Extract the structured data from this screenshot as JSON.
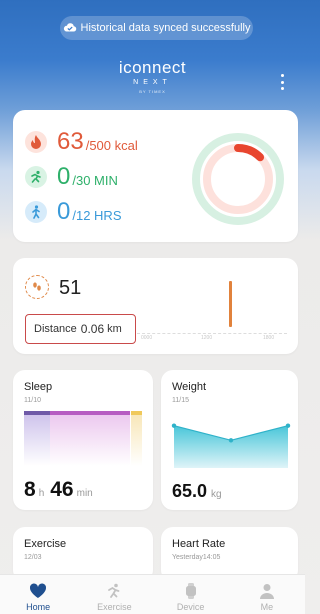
{
  "toast": {
    "text": "Historical data synced successfully",
    "icon": "cloud-check-icon"
  },
  "brand": {
    "name": "iconnect",
    "sub": "NEXT",
    "by": "BY TIMEX"
  },
  "activity": {
    "calories": {
      "value": "63",
      "goal": "/500 kcal",
      "color": "#e05a3a",
      "icon": "flame-icon"
    },
    "exercise": {
      "value": "0",
      "goal": "/30 MIN",
      "color": "#2eb06a",
      "icon": "running-icon"
    },
    "hours": {
      "value": "0",
      "goal": "/12 HRS",
      "color": "#3a9ad9",
      "icon": "walking-icon"
    },
    "rings": {
      "calories_progress": 0.126,
      "exercise_progress": 0,
      "hours_progress": 0
    }
  },
  "steps": {
    "value": "51",
    "distance_label": "Distance",
    "distance_value": "0.06",
    "distance_unit": "km",
    "axis_ticks": [
      "0000",
      "1200",
      "1800"
    ],
    "icon": "footsteps-icon"
  },
  "sleep": {
    "title": "Sleep",
    "date": "11/10",
    "hours": "8",
    "hours_unit": "h",
    "minutes": "46",
    "minutes_unit": "min"
  },
  "weight": {
    "title": "Weight",
    "date": "11/15",
    "value": "65.0",
    "unit": "kg",
    "points": [
      0.82,
      0.55,
      0.82
    ]
  },
  "exercise_card": {
    "title": "Exercise",
    "date": "12/03"
  },
  "heart": {
    "title": "Heart Rate",
    "date": "Yesterday14:05"
  },
  "tabs": [
    {
      "label": "Home",
      "icon": "heart-icon",
      "active": true
    },
    {
      "label": "Exercise",
      "icon": "runner-icon",
      "active": false
    },
    {
      "label": "Device",
      "icon": "watch-icon",
      "active": false
    },
    {
      "label": "Me",
      "icon": "person-icon",
      "active": false
    }
  ]
}
